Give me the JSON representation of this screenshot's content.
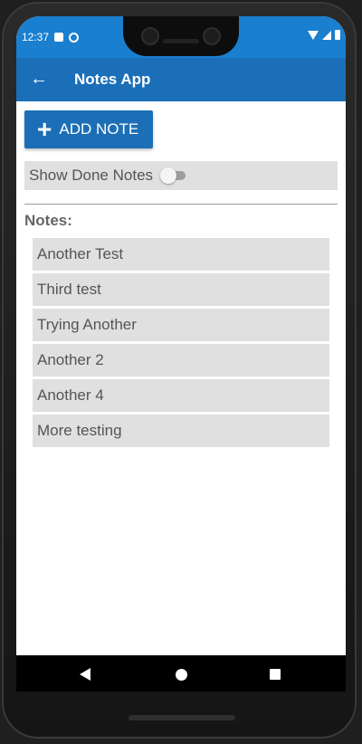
{
  "status_bar": {
    "time": "12:37"
  },
  "app_bar": {
    "back_icon": "arrow-left-icon",
    "title": "Notes App"
  },
  "actions": {
    "add_note_label": "ADD NOTE",
    "add_icon": "plus-icon"
  },
  "filter": {
    "show_done_label": "Show Done Notes",
    "show_done_enabled": false
  },
  "notes": {
    "label": "Notes:",
    "items": [
      {
        "text": "Another Test"
      },
      {
        "text": "Third test"
      },
      {
        "text": "Trying Another"
      },
      {
        "text": "Another 2"
      },
      {
        "text": "Another 4"
      },
      {
        "text": "More testing"
      }
    ]
  },
  "nav": {
    "back_icon": "nav-back-icon",
    "home_icon": "nav-home-icon",
    "recent_icon": "nav-recent-icon"
  },
  "colors": {
    "app_bar": "#1a6fb8",
    "status_bar": "#1a7fcf",
    "button": "#1c6fb7",
    "row_bg": "#e0e0e0"
  }
}
